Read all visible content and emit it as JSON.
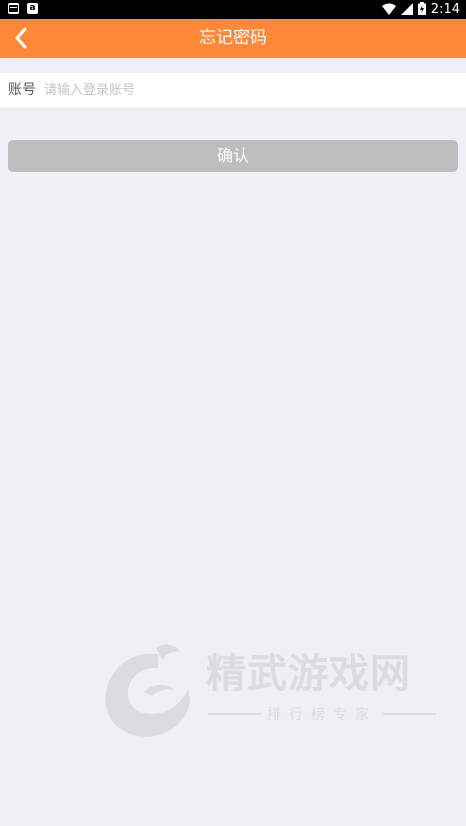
{
  "status_bar": {
    "time": "2:14",
    "notification_icon_1": "sim-card-icon",
    "notification_icon_2": "a",
    "wifi_icon": "wifi-icon",
    "signal_icon": "signal-icon",
    "battery_icon": "battery-charging-icon"
  },
  "header": {
    "title": "忘记密码",
    "back_icon": "chevron-left-icon",
    "background": "#ff8838"
  },
  "form": {
    "account_label": "账号",
    "account_value": "",
    "account_placeholder": "请输入登录账号"
  },
  "confirm_button": {
    "label": "确认",
    "background": "#bdbdbd"
  },
  "watermark": {
    "brand": "精武游戏网",
    "tagline": "排行榜专家",
    "logo_icon": "brand-logo-icon"
  }
}
